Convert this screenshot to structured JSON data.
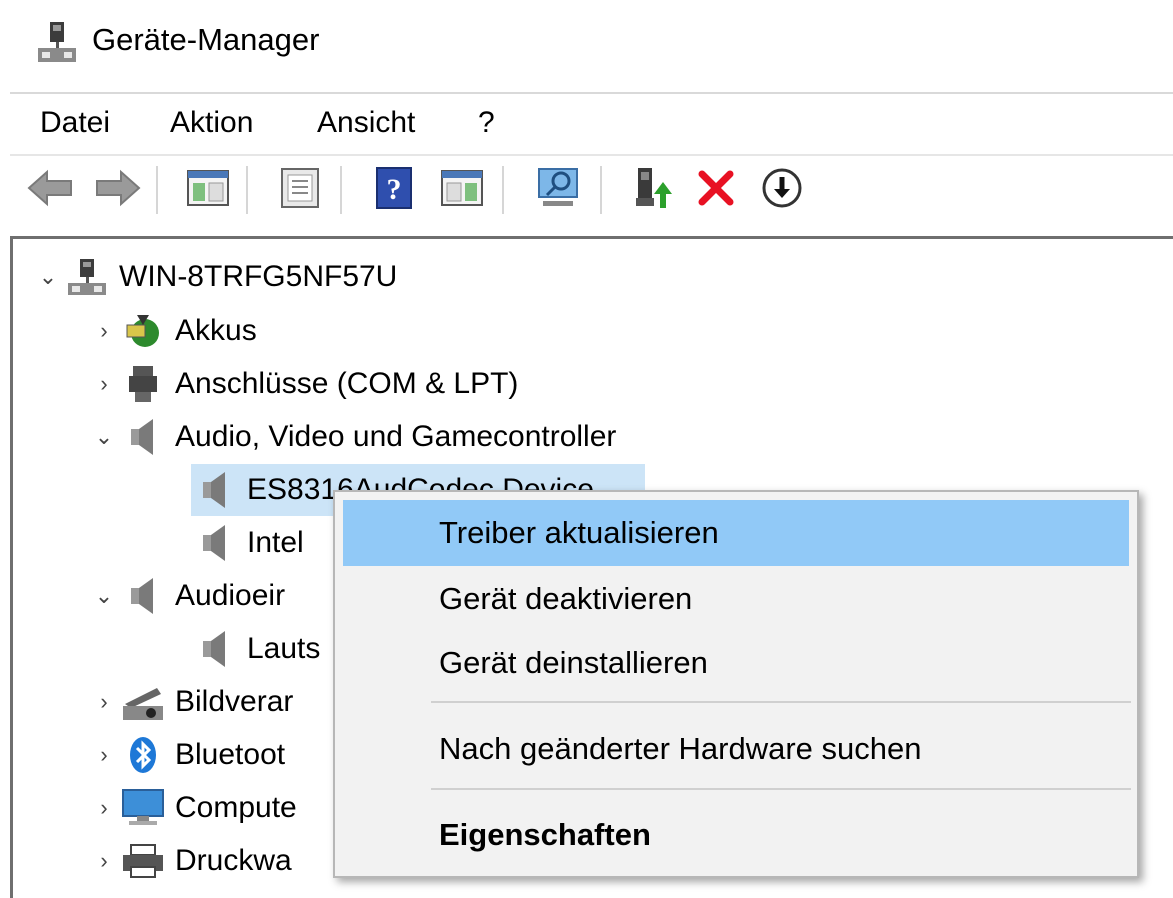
{
  "window": {
    "title": "Geräte-Manager"
  },
  "menu": {
    "items": [
      "Datei",
      "Aktion",
      "Ansicht",
      "?"
    ]
  },
  "toolbar": {
    "icons": [
      "back-arrow-icon",
      "forward-arrow-icon",
      "show-hide-console-tree-icon",
      "properties-icon",
      "help-icon",
      "action-pane-icon",
      "scan-hardware-icon",
      "update-driver-icon",
      "uninstall-icon",
      "disable-device-icon"
    ]
  },
  "tree": {
    "root": "WIN-8TRFG5NF57U",
    "items": [
      {
        "label": "Akkus"
      },
      {
        "label": "Anschlüsse (COM & LPT)"
      },
      {
        "label": "Audio, Video und Gamecontroller"
      },
      {
        "label": "ES8316AudCodec Device"
      },
      {
        "label": "Intel"
      },
      {
        "label": "Audioeir"
      },
      {
        "label": "Lauts"
      },
      {
        "label": "Bildverar"
      },
      {
        "label": "Bluetoot"
      },
      {
        "label": "Compute"
      },
      {
        "label": "Druckwa"
      }
    ]
  },
  "context_menu": {
    "items": [
      {
        "label": "Treiber aktualisieren",
        "highlighted": true
      },
      {
        "label": "Gerät deaktivieren"
      },
      {
        "label": "Gerät deinstallieren"
      },
      {
        "label": "Nach geänderter Hardware suchen"
      },
      {
        "label": "Eigenschaften",
        "bold": true
      }
    ]
  },
  "colors": {
    "selection": "#cce4f7",
    "menu_highlight": "#91c9f7",
    "delete_red": "#e81123"
  }
}
